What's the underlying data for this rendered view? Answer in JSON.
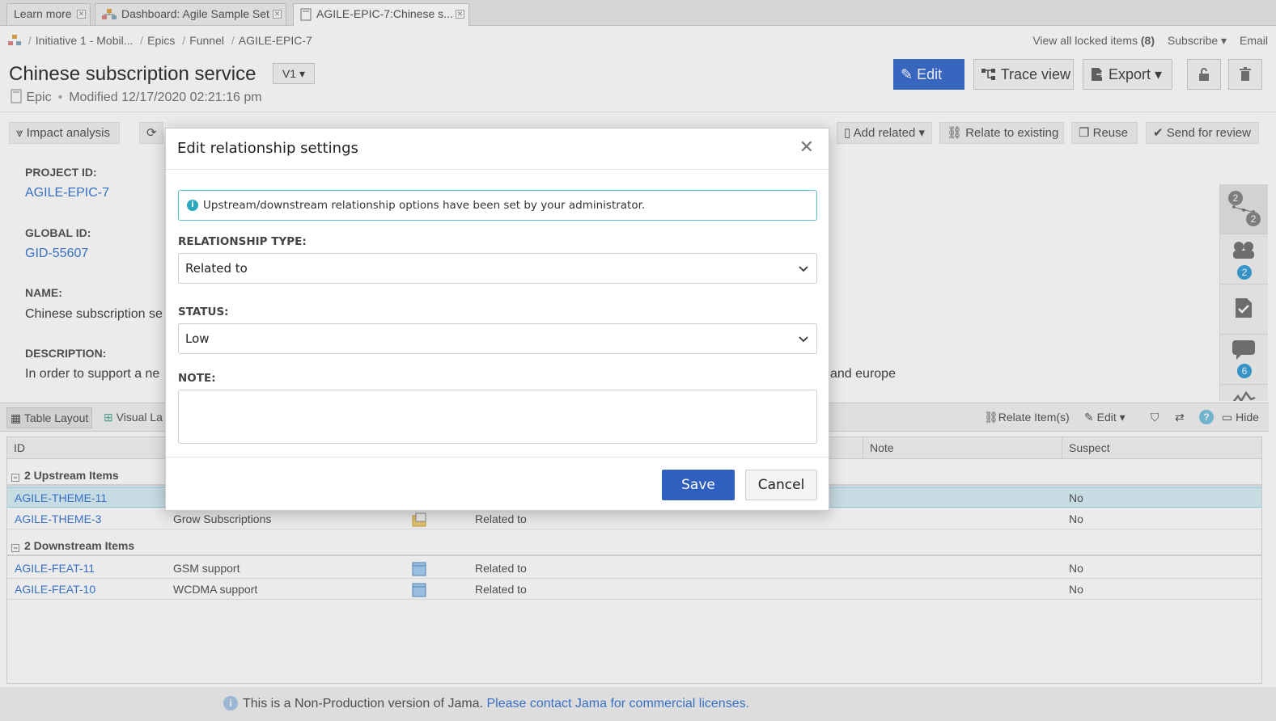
{
  "tabs": [
    {
      "label": "Learn more"
    },
    {
      "label": "Dashboard: Agile Sample Set"
    },
    {
      "label": "AGILE-EPIC-7:Chinese s..."
    }
  ],
  "breadcrumb": [
    "Initiative 1 - Mobil...",
    "Epics",
    "Funnel",
    "AGILE-EPIC-7"
  ],
  "topright": {
    "locked_label": "View all locked items",
    "locked_count": "(8)",
    "subscribe": "Subscribe",
    "email": "Email"
  },
  "item": {
    "title": "Chinese subscription service",
    "version": "V1",
    "type": "Epic",
    "modified": "Modified 12/17/2020 02:21:16 pm"
  },
  "header_buttons": {
    "edit": "Edit",
    "trace": "Trace view",
    "export": "Export"
  },
  "toolbar": {
    "impact": "Impact analysis",
    "add_related": "Add related",
    "relate_existing": "Relate to existing",
    "reuse": "Reuse",
    "send_review": "Send for review"
  },
  "fields": {
    "project_id_label": "PROJECT ID:",
    "project_id": "AGILE-EPIC-7",
    "global_id_label": "GLOBAL ID:",
    "global_id": "GID-55607",
    "name_label": "NAME:",
    "name": "Chinese subscription se",
    "description_label": "DESCRIPTION:",
    "description_start": "In order to support a ne",
    "description_end": "and europe"
  },
  "sidepanel": {
    "trace_up": "2",
    "trace_down": "2",
    "people": "2",
    "comments": "6"
  },
  "relations": {
    "table_layout": "Table Layout",
    "visual_layout": "Visual La",
    "relate_items": "Relate Item(s)",
    "edit": "Edit",
    "hide": "Hide",
    "columns": {
      "id": "ID",
      "note": "Note",
      "suspect": "Suspect"
    },
    "upstream_label": "2 Upstream Items",
    "downstream_label": "2 Downstream Items",
    "upstream": [
      {
        "id": "AGILE-THEME-11",
        "name": "",
        "rel": "",
        "suspect": "No"
      },
      {
        "id": "AGILE-THEME-3",
        "name": "Grow Subscriptions",
        "rel": "Related to",
        "suspect": "No"
      }
    ],
    "downstream": [
      {
        "id": "AGILE-FEAT-11",
        "name": "GSM support",
        "rel": "Related to",
        "suspect": "No"
      },
      {
        "id": "AGILE-FEAT-10",
        "name": "WCDMA support",
        "rel": "Related to",
        "suspect": "No"
      }
    ]
  },
  "footer": {
    "text": "This is a Non-Production version of Jama.",
    "link": "Please contact Jama for commercial licenses."
  },
  "modal": {
    "title": "Edit relationship settings",
    "info": "Upstream/downstream relationship options have been set by your administrator.",
    "type_label": "RELATIONSHIP TYPE:",
    "type_value": "Related to",
    "status_label": "STATUS:",
    "status_value": "Low",
    "note_label": "NOTE:",
    "save": "Save",
    "cancel": "Cancel"
  },
  "colors": {
    "primary": "#2f5fbf",
    "link": "#3d7ad6",
    "info_border": "#5bbdcc",
    "highlight_row": "#d7eef6"
  }
}
